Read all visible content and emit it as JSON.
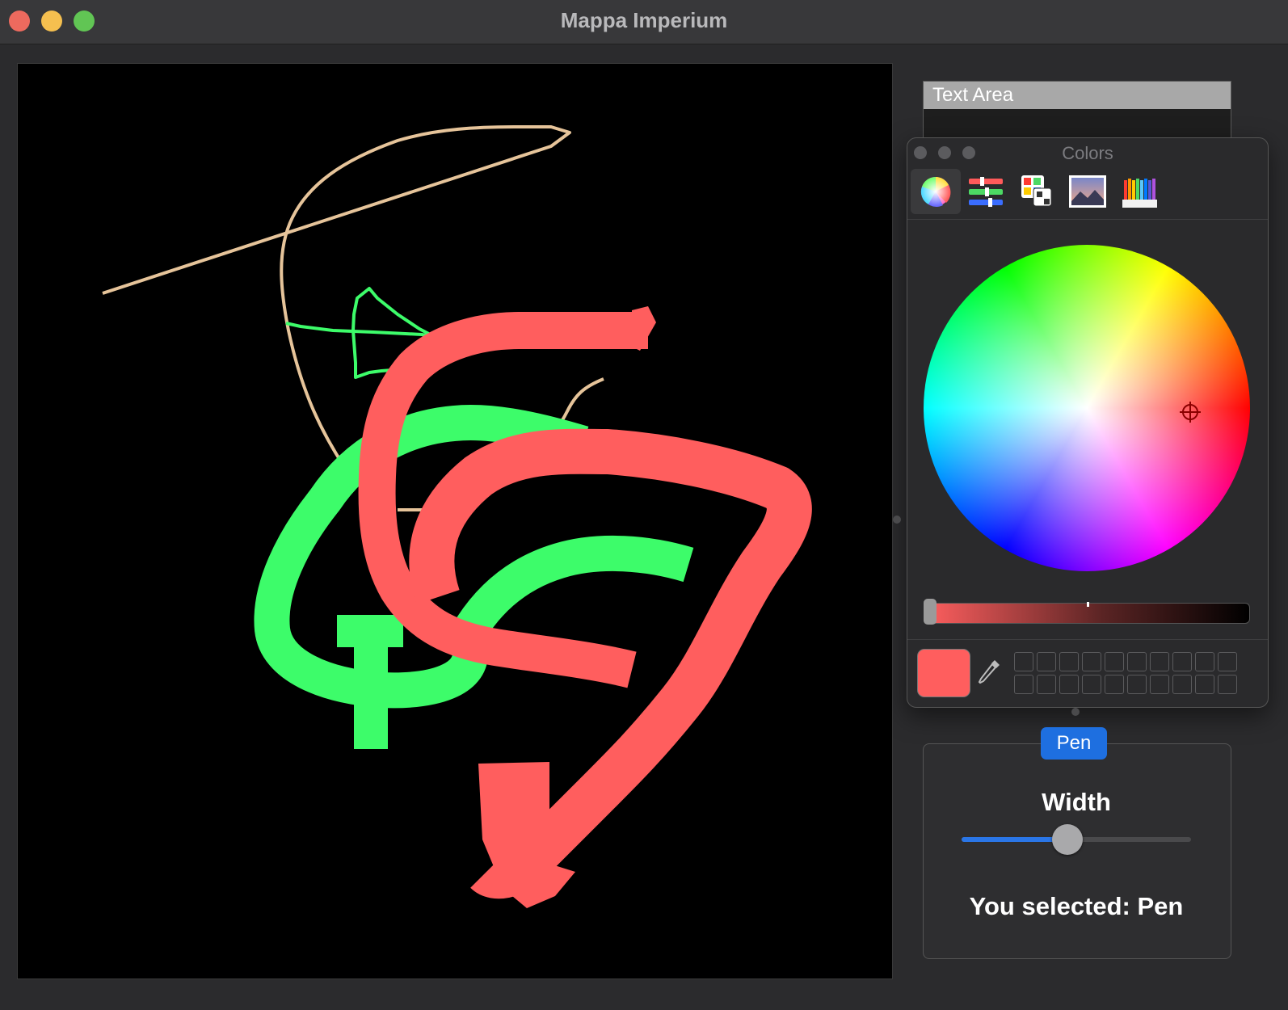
{
  "window": {
    "title": "Mappa Imperium"
  },
  "text_area": {
    "header": "Text Area"
  },
  "colors_panel": {
    "title": "Colors",
    "tools": [
      "color-wheel-icon",
      "color-sliders-icon",
      "color-palettes-icon",
      "image-palettes-icon",
      "pencils-icon"
    ],
    "selected_tool": "color-wheel-icon",
    "current_color": "#ff5e5e"
  },
  "pen_panel": {
    "tab_label": "Pen",
    "width_label": "Width",
    "width_value": 0.46,
    "selected_text": "You selected: Pen"
  },
  "canvas": {
    "stroke_colors": [
      "#e6c49a",
      "#3dfc6a",
      "#ff5e5e"
    ]
  }
}
